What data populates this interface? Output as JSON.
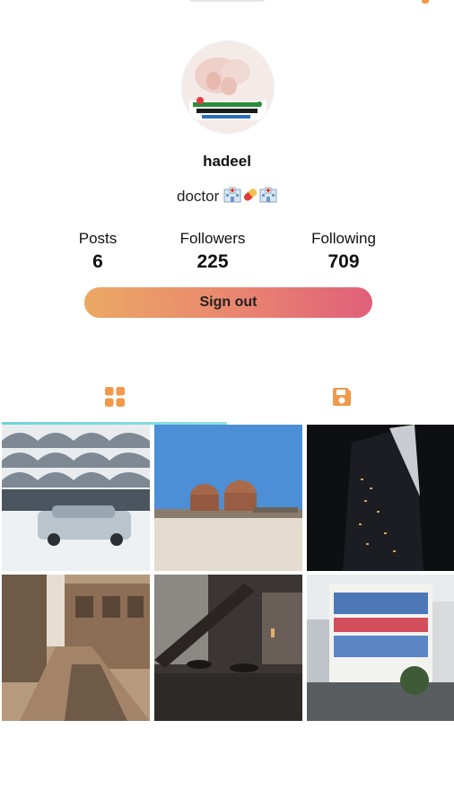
{
  "profile": {
    "username": "hadeel",
    "bio_text": "doctor",
    "bio_emojis": [
      "hospital-icon",
      "pill-icon",
      "hospital-icon"
    ]
  },
  "stats": [
    {
      "label": "Posts",
      "value": "6"
    },
    {
      "label": "Followers",
      "value": "225"
    },
    {
      "label": "Following",
      "value": "709"
    }
  ],
  "actions": {
    "sign_out_label": "Sign out"
  },
  "tabs": [
    {
      "icon": "grid-icon",
      "active": true
    },
    {
      "icon": "save-icon",
      "active": false
    }
  ],
  "colors": {
    "accent_orange": "#f2994a",
    "gradient_start": "#eba863",
    "gradient_end": "#e0607a",
    "tab_indicator": "#6fd3d6"
  },
  "posts": [
    {
      "subject": "white concrete lattice building with parked car"
    },
    {
      "subject": "two round water tanks under blue sky"
    },
    {
      "subject": "dark glass skyscraper at night"
    },
    {
      "subject": "old narrow alley with wooden balconies"
    },
    {
      "subject": "industrial interior with staircase"
    },
    {
      "subject": "building with blue and red windows"
    }
  ]
}
